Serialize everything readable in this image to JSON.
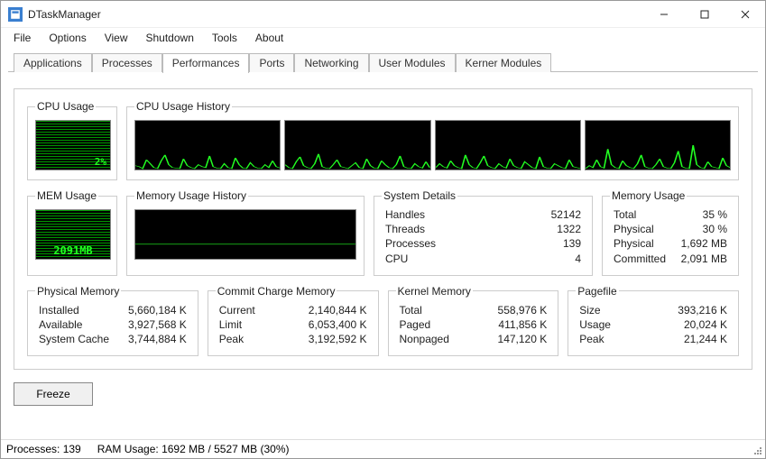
{
  "window": {
    "title": "DTaskManager"
  },
  "menu": {
    "items": [
      "File",
      "Options",
      "View",
      "Shutdown",
      "Tools",
      "About"
    ]
  },
  "tabs": {
    "items": [
      "Applications",
      "Processes",
      "Performances",
      "Ports",
      "Networking",
      "User Modules",
      "Kerner Modules"
    ],
    "active": 2
  },
  "legends": {
    "cpu_usage": "CPU Usage",
    "cpu_hist": "CPU Usage History",
    "mem_usage": "MEM Usage",
    "mem_hist": "Memory Usage History",
    "system_details": "System Details",
    "memory_usage": "Memory Usage",
    "physical_memory": "Physical Memory",
    "commit_charge": "Commit Charge Memory",
    "kernel_memory": "Kernel Memory",
    "pagefile": "Pagefile"
  },
  "meters": {
    "cpu": "2%",
    "mem": "2091MB"
  },
  "system_details": {
    "rows": [
      {
        "label": "Handles",
        "value": "52142"
      },
      {
        "label": "Threads",
        "value": "1322"
      },
      {
        "label": "Processes",
        "value": "139"
      },
      {
        "label": "CPU",
        "value": "4"
      }
    ]
  },
  "memory_usage": {
    "rows": [
      {
        "label": "Total",
        "value": "35 %"
      },
      {
        "label": "Physical",
        "value": "30 %"
      },
      {
        "label": "Physical",
        "value": "1,692 MB"
      },
      {
        "label": "Committed",
        "value": "2,091 MB"
      }
    ]
  },
  "physical_memory": {
    "rows": [
      {
        "label": "Installed",
        "value": "5,660,184 K"
      },
      {
        "label": "Available",
        "value": "3,927,568 K"
      },
      {
        "label": "System Cache",
        "value": "3,744,884 K"
      }
    ]
  },
  "commit_charge": {
    "rows": [
      {
        "label": "Current",
        "value": "2,140,844 K"
      },
      {
        "label": "Limit",
        "value": "6,053,400 K"
      },
      {
        "label": "Peak",
        "value": "3,192,592 K"
      }
    ]
  },
  "kernel_memory": {
    "rows": [
      {
        "label": "Total",
        "value": "558,976 K"
      },
      {
        "label": "Paged",
        "value": "411,856 K"
      },
      {
        "label": "Nonpaged",
        "value": "147,120 K"
      }
    ]
  },
  "pagefile": {
    "rows": [
      {
        "label": "Size",
        "value": "393,216 K"
      },
      {
        "label": "Usage",
        "value": "20,024 K"
      },
      {
        "label": "Peak",
        "value": "21,244 K"
      }
    ]
  },
  "buttons": {
    "freeze": "Freeze"
  },
  "status": {
    "processes": "Processes: 139",
    "ram": "RAM Usage:  1692 MB / 5527 MB (30%)"
  },
  "chart_data": [
    {
      "type": "line",
      "title": "CPU Usage History (core 1)",
      "ylim": [
        0,
        100
      ],
      "values": [
        8,
        6,
        2,
        20,
        12,
        4,
        2,
        18,
        30,
        10,
        4,
        3,
        2,
        22,
        8,
        4,
        2,
        10,
        6,
        4,
        28,
        6,
        3,
        2,
        12,
        4,
        2,
        24,
        10,
        3,
        2,
        14,
        6,
        3,
        2,
        10,
        4,
        18,
        6,
        3
      ]
    },
    {
      "type": "line",
      "title": "CPU Usage History (core 2)",
      "ylim": [
        0,
        100
      ],
      "values": [
        10,
        4,
        2,
        16,
        26,
        8,
        4,
        2,
        12,
        32,
        6,
        3,
        2,
        10,
        20,
        6,
        4,
        2,
        8,
        14,
        4,
        2,
        22,
        8,
        3,
        2,
        18,
        10,
        4,
        2,
        10,
        28,
        6,
        3,
        2,
        12,
        6,
        3,
        16,
        4
      ]
    },
    {
      "type": "line",
      "title": "CPU Usage History (core 3)",
      "ylim": [
        0,
        100
      ],
      "values": [
        4,
        12,
        6,
        3,
        18,
        8,
        4,
        2,
        30,
        10,
        4,
        2,
        14,
        28,
        8,
        4,
        2,
        12,
        6,
        3,
        22,
        8,
        4,
        2,
        16,
        10,
        4,
        2,
        26,
        6,
        3,
        2,
        12,
        8,
        4,
        2,
        20,
        6,
        4,
        2
      ]
    },
    {
      "type": "line",
      "title": "CPU Usage History (core 4)",
      "ylim": [
        0,
        100
      ],
      "values": [
        2,
        8,
        4,
        20,
        6,
        3,
        42,
        10,
        4,
        2,
        18,
        8,
        4,
        2,
        12,
        30,
        6,
        3,
        2,
        10,
        22,
        6,
        3,
        2,
        14,
        38,
        6,
        3,
        2,
        50,
        10,
        4,
        2,
        16,
        6,
        4,
        2,
        24,
        8,
        4
      ]
    },
    {
      "type": "line",
      "title": "Memory Usage History",
      "ylim": [
        0,
        100
      ],
      "values": [
        30,
        30,
        30,
        30,
        30,
        30,
        30,
        30,
        30,
        30,
        30,
        30,
        30,
        30,
        30,
        30,
        30,
        30,
        30,
        30,
        30,
        30,
        30,
        30,
        30,
        30,
        30,
        30,
        30,
        30,
        30,
        30,
        30,
        30,
        30,
        30,
        30,
        30,
        30,
        30
      ]
    }
  ]
}
